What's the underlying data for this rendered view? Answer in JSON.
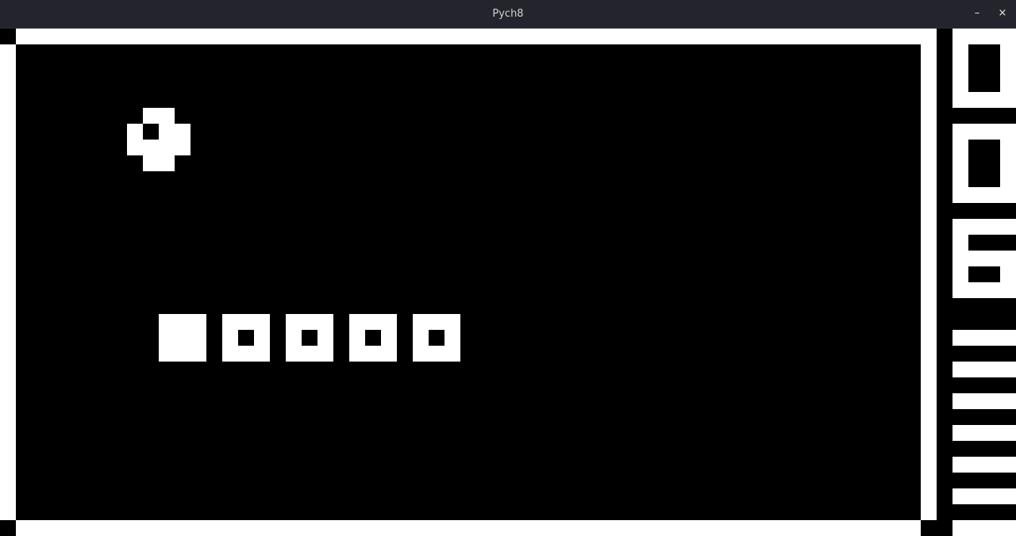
{
  "window": {
    "title": "Pych8",
    "minimize_glyph": "–",
    "close_glyph": "×"
  },
  "display": {
    "resolution": "64x32",
    "colors": {
      "on": "#ffffff",
      "off": "#000000",
      "titlebar": "#24242c"
    }
  },
  "game": {
    "ball_icon": "ball-sprite",
    "bricks": [
      {
        "state": "solid"
      },
      {
        "state": "hollow"
      },
      {
        "state": "hollow"
      },
      {
        "state": "hollow"
      },
      {
        "state": "hollow"
      }
    ]
  }
}
